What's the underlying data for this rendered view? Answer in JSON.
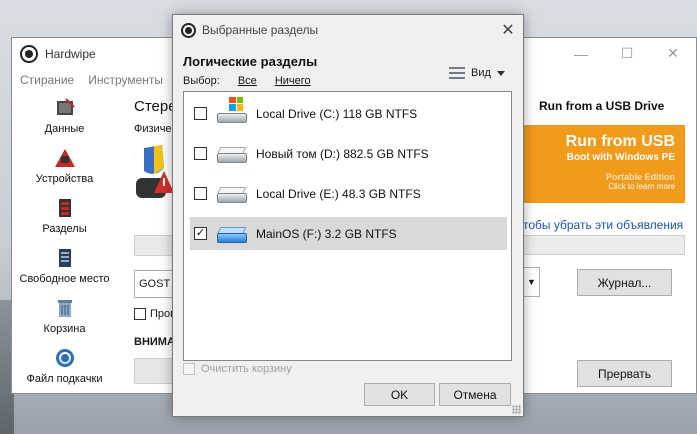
{
  "main_window": {
    "title": "Hardwipe",
    "menu": [
      "Стирание",
      "Инструменты"
    ],
    "nav": [
      {
        "label": "Данные",
        "icon": "data-icon"
      },
      {
        "label": "Устройства",
        "icon": "devices-icon"
      },
      {
        "label": "Разделы",
        "icon": "partitions-icon"
      },
      {
        "label": "Свободное место",
        "icon": "free-space-icon"
      },
      {
        "label": "Корзина",
        "icon": "recycle-bin-icon"
      },
      {
        "label": "Файл подкачки",
        "icon": "pagefile-icon"
      }
    ],
    "content_heading": "Стере",
    "content_subheading": "Физичес",
    "gost_value": "GOST R",
    "check_label": "Пров",
    "warning_text": "ВНИМА",
    "ad_title": "Run from a USB Drive",
    "ad_banner": {
      "line1": "Run from USB",
      "line2": "Boot with Windows PE",
      "line3": "Portable Edition",
      "line4": "Click to learn more"
    },
    "ad_link": "тобы убрать эти объявления",
    "journal_button": "Журнал...",
    "abort_button": "Прервать"
  },
  "dialog": {
    "title": "Выбранные разделы",
    "heading": "Логические разделы",
    "select_label": "Выбор:",
    "select_all": "Все",
    "select_none": "Ничего",
    "view_label": "Вид",
    "partitions": [
      {
        "label": "Local Drive (C:) 118 GB NTFS",
        "checked": false,
        "selected": false,
        "icon": "system-drive-icon"
      },
      {
        "label": "Новый том (D:) 882.5 GB NTFS",
        "checked": false,
        "selected": false,
        "icon": "drive-icon"
      },
      {
        "label": "Local Drive (E:) 48.3 GB NTFS",
        "checked": false,
        "selected": false,
        "icon": "drive-icon"
      },
      {
        "label": "MainOS (F:) 3.2 GB NTFS",
        "checked": true,
        "selected": true,
        "icon": "usb-drive-icon"
      }
    ],
    "empty_bin_label": "Очистить корзину",
    "ok_button": "OK",
    "cancel_button": "Отмена"
  },
  "colors": {
    "ad_orange": "#f29a1a",
    "link_blue": "#1c55a8",
    "selected_row": "#d9d9d9"
  }
}
